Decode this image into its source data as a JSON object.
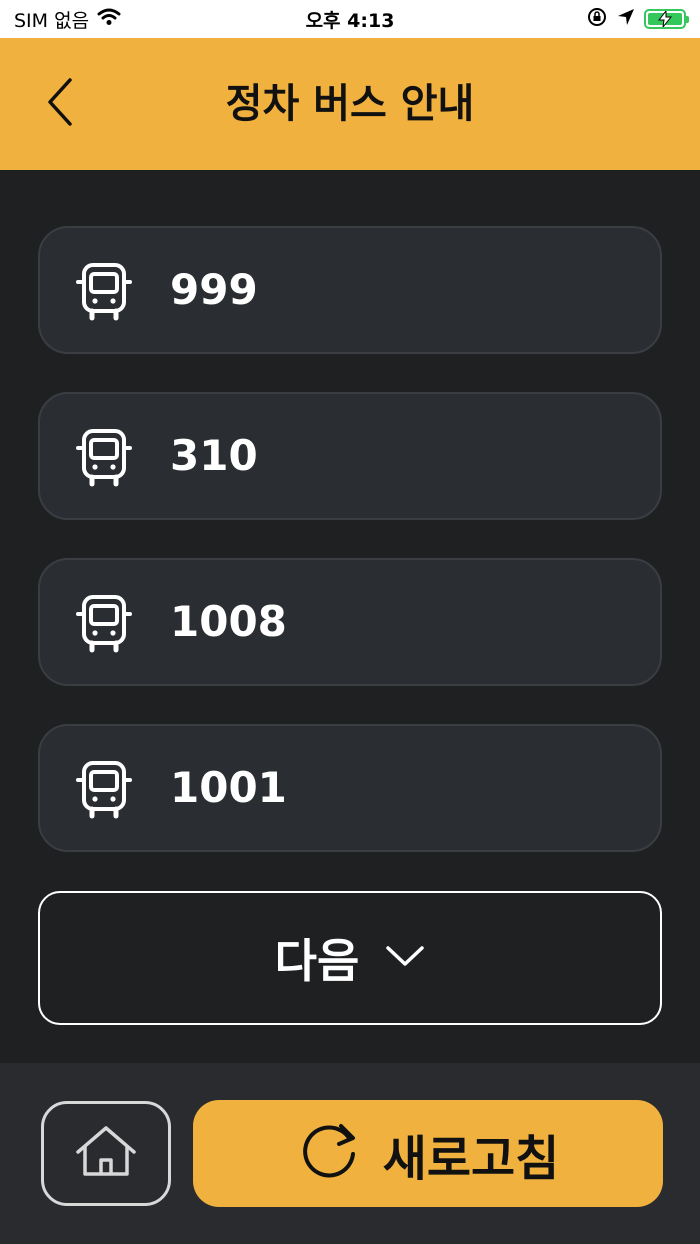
{
  "status_bar": {
    "carrier": "SIM 없음",
    "time": "오후 4:13",
    "battery_color": "#34c759"
  },
  "header": {
    "title": "정차 버스 안내",
    "background": "#f0b13e",
    "back_icon": "chevron-left-icon"
  },
  "bus_list": {
    "items": [
      {
        "number": "999",
        "icon": "bus-icon"
      },
      {
        "number": "310",
        "icon": "bus-icon"
      },
      {
        "number": "1008",
        "icon": "bus-icon"
      },
      {
        "number": "1001",
        "icon": "bus-icon"
      }
    ]
  },
  "next_button": {
    "label": "다음",
    "icon": "chevron-down-icon"
  },
  "bottom_bar": {
    "home_icon": "home-icon",
    "refresh_label": "새로고침",
    "refresh_icon": "refresh-icon",
    "accent": "#f0b13e"
  }
}
